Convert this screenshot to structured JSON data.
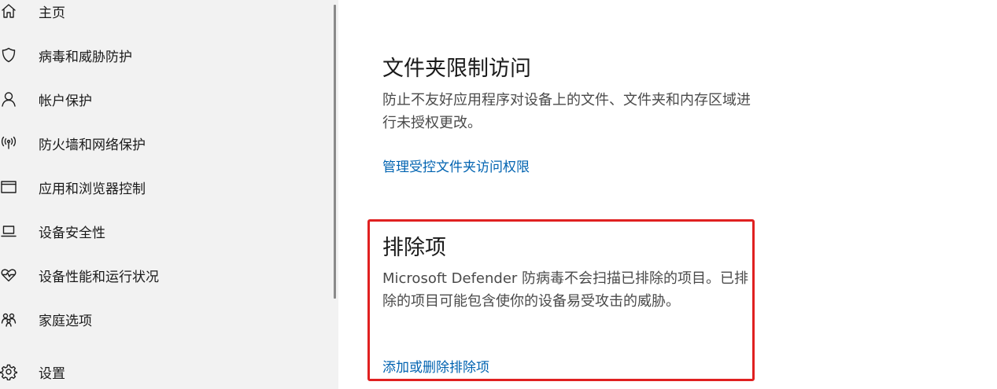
{
  "sidebar": {
    "items": [
      {
        "label": "主页",
        "icon": "home-icon"
      },
      {
        "label": "病毒和威胁防护",
        "icon": "shield-icon"
      },
      {
        "label": "帐户保护",
        "icon": "person-icon"
      },
      {
        "label": "防火墙和网络保护",
        "icon": "wifi-signal-icon"
      },
      {
        "label": "应用和浏览器控制",
        "icon": "browser-window-icon"
      },
      {
        "label": "设备安全性",
        "icon": "laptop-icon"
      },
      {
        "label": "设备性能和运行状况",
        "icon": "heart-pulse-icon"
      },
      {
        "label": "家庭选项",
        "icon": "family-icon"
      },
      {
        "label": "设置",
        "icon": "gear-icon"
      }
    ]
  },
  "main": {
    "folder_access": {
      "title": "文件夹限制访问",
      "description": "防止不友好应用程序对设备上的文件、文件夹和内存区域进行未授权更改。",
      "link": "管理受控文件夹访问权限"
    },
    "exclusions": {
      "title": "排除项",
      "description": "Microsoft Defender 防病毒不会扫描已排除的项目。已排除的项目可能包含使你的设备易受攻击的威胁。",
      "link": "添加或删除排除项"
    }
  },
  "colors": {
    "link": "#0063b1",
    "highlight": "#e02020",
    "sidebar_bg": "#f2f2f2"
  }
}
